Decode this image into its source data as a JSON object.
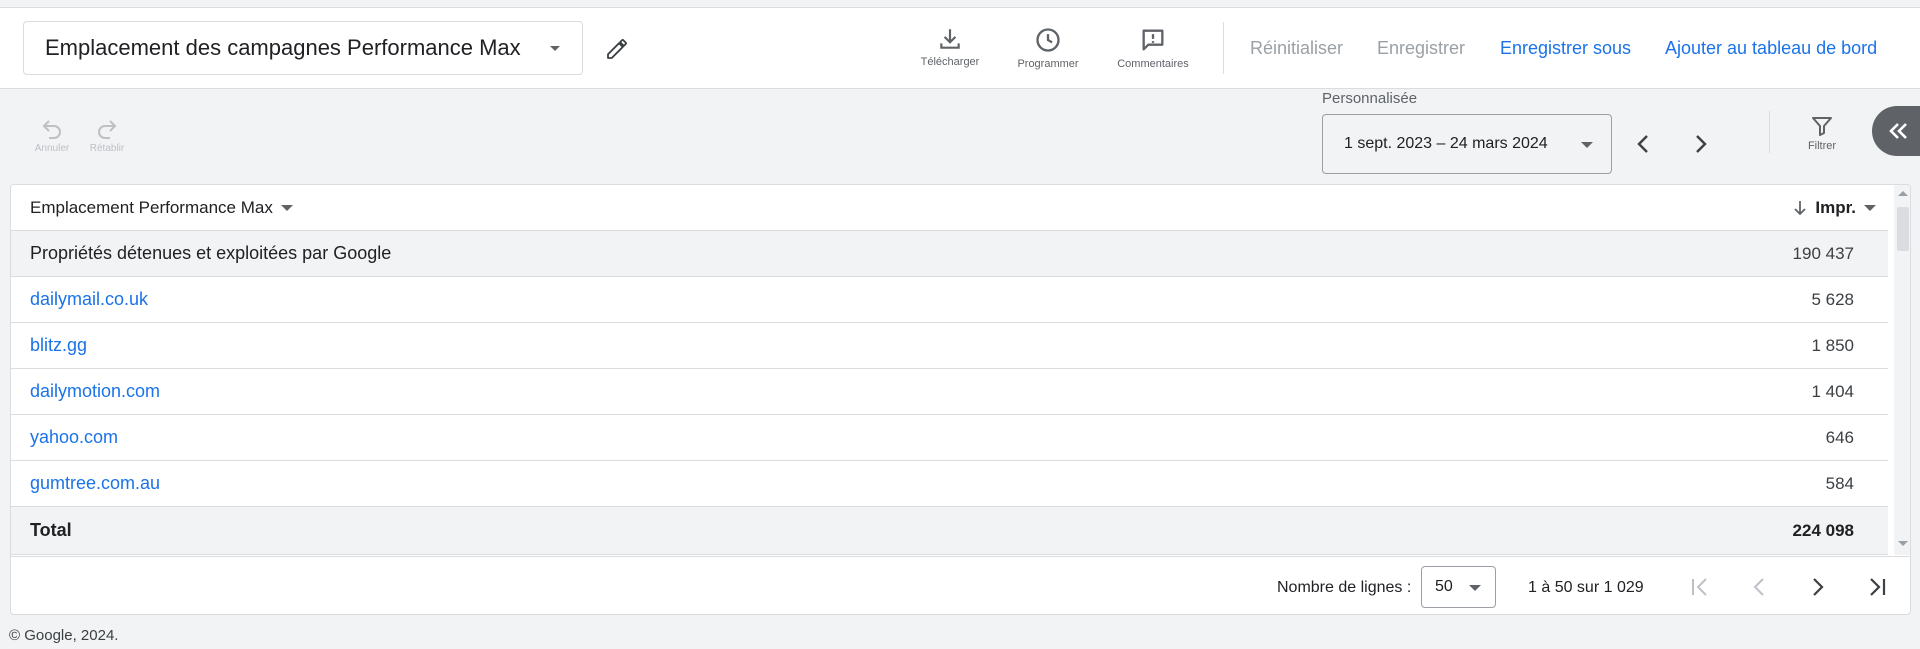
{
  "header": {
    "report_title": "Emplacement des campagnes Performance Max",
    "tools": [
      {
        "label": "Télécharger",
        "icon": "download-icon"
      },
      {
        "label": "Programmer",
        "icon": "clock-icon"
      },
      {
        "label": "Commentaires",
        "icon": "comment-icon"
      }
    ],
    "actions": {
      "reset": "Réinitialiser",
      "save": "Enregistrer",
      "save_as": "Enregistrer sous",
      "add_dashboard": "Ajouter au tableau de bord"
    }
  },
  "toolbar": {
    "undo": "Annuler",
    "redo": "Rétablir",
    "date_caption": "Personnalisée",
    "date_range": "1 sept. 2023 – 24 mars 2024",
    "filter": "Filtrer"
  },
  "table": {
    "columns": {
      "placement": "Emplacement Performance Max",
      "impressions": "Impr."
    },
    "rows": [
      {
        "placement": "Propriétés détenues et exploitées par Google",
        "impressions": "190 437",
        "link": false
      },
      {
        "placement": "dailymail.co.uk",
        "impressions": "5 628",
        "link": true
      },
      {
        "placement": "blitz.gg",
        "impressions": "1 850",
        "link": true
      },
      {
        "placement": "dailymotion.com",
        "impressions": "1 404",
        "link": true
      },
      {
        "placement": "yahoo.com",
        "impressions": "646",
        "link": true
      },
      {
        "placement": "gumtree.com.au",
        "impressions": "584",
        "link": true
      }
    ],
    "total": {
      "label": "Total",
      "impressions": "224 098"
    }
  },
  "pagination": {
    "rows_label": "Nombre de lignes :",
    "rows_value": "50",
    "range": "1 à 50 sur 1 029"
  },
  "footer": {
    "copyright": "© Google, 2024."
  },
  "colors": {
    "link": "#1a73e8",
    "disabled": "#9aa0a6",
    "muted": "#5f6368",
    "background": "#f1f3f4"
  }
}
